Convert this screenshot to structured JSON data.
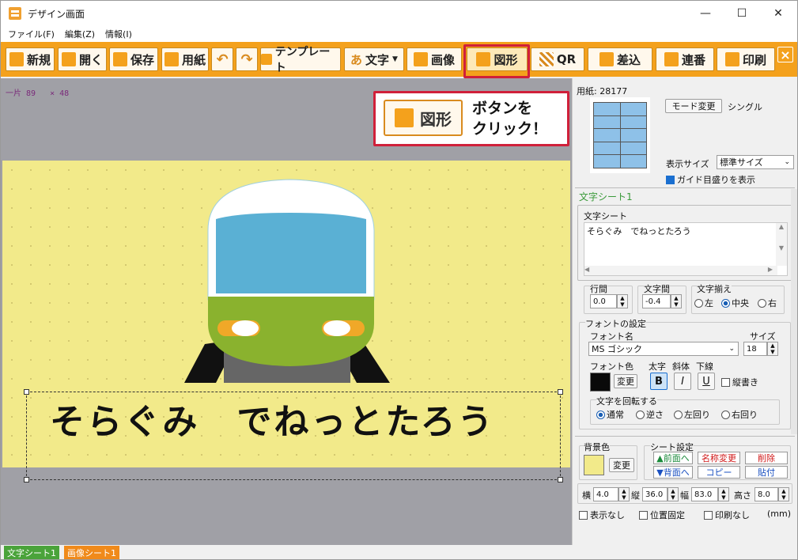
{
  "window": {
    "title": "デザイン画面",
    "minimize": "—",
    "maximize": "☐",
    "close": "✕"
  },
  "menu": [
    "ファイル(F)",
    "編集(Z)",
    "情報(I)"
  ],
  "toolbar": {
    "new": "新規",
    "open": "開く",
    "save": "保存",
    "paper": "用紙",
    "template": "テンプレート",
    "text": "文字",
    "image": "画像",
    "shape": "図形",
    "qr": "QR",
    "merge": "差込",
    "serial": "連番",
    "print": "印刷",
    "close_label": "×"
  },
  "canvas": {
    "coords_a": "一片 89",
    "coords_b": "× 48",
    "main_text": "そらぐみ　でねっとたろう"
  },
  "callout": {
    "button_label": "図形",
    "line1": "ボタンを",
    "line2": "クリック！"
  },
  "panel": {
    "paper_label": "用紙: 28177",
    "mode_button": "モード変更",
    "mode_value": "シングル",
    "display_size_label": "表示サイズ",
    "display_size_value": "標準サイズ",
    "guide_label": "ガイド目盛りを表示",
    "sheet_tab": "文字シート1",
    "text_sheet_group": "文字シート",
    "text_content": "そらぐみ　でねっとたろう",
    "line_spacing_label": "行間",
    "line_spacing_value": "0.0",
    "char_spacing_label": "文字間",
    "char_spacing_value": "-0.4",
    "align_label": "文字揃え",
    "align_left": "左",
    "align_center": "中央",
    "align_right": "右",
    "font_settings": "フォントの設定",
    "font_name_label": "フォント名",
    "font_name_value": "MS ゴシック",
    "size_label": "サイズ",
    "size_value": "18",
    "font_color_label": "フォント色",
    "change": "変更",
    "bold_label": "太字",
    "italic_label": "斜体",
    "underline_label": "下線",
    "bold_btn": "B",
    "italic_btn": "I",
    "underline_btn": "U",
    "vertical_label": "縦書き",
    "rotate_label": "文字を回転する",
    "rot_normal": "通常",
    "rot_reverse": "逆さ",
    "rot_left": "左回り",
    "rot_right": "右回り",
    "bg_color_label": "背景色",
    "sheet_settings": "シート設定",
    "front": "▲前面へ",
    "back": "▼背面へ",
    "rename": "名称変更",
    "copy": "コピー",
    "delete": "削除",
    "paste": "貼付",
    "x_label": "横",
    "x_value": "4.0",
    "y_label": "縦",
    "y_value": "36.0",
    "w_label": "幅",
    "w_value": "83.0",
    "h_label": "高さ",
    "h_value": "8.0",
    "hide_label": "表示なし",
    "lock_label": "位置固定",
    "noprint_label": "印刷なし",
    "unit": "(mm)"
  },
  "tabs": {
    "text_sheet": "文字シート1",
    "image_sheet": "画像シート1"
  },
  "colors": {
    "toolbar": "#f4a11c",
    "accent_red": "#d0203a",
    "sheet_bg": "#f2ea8a",
    "train_green": "#8ab22e",
    "train_window": "#5ab0d4"
  }
}
